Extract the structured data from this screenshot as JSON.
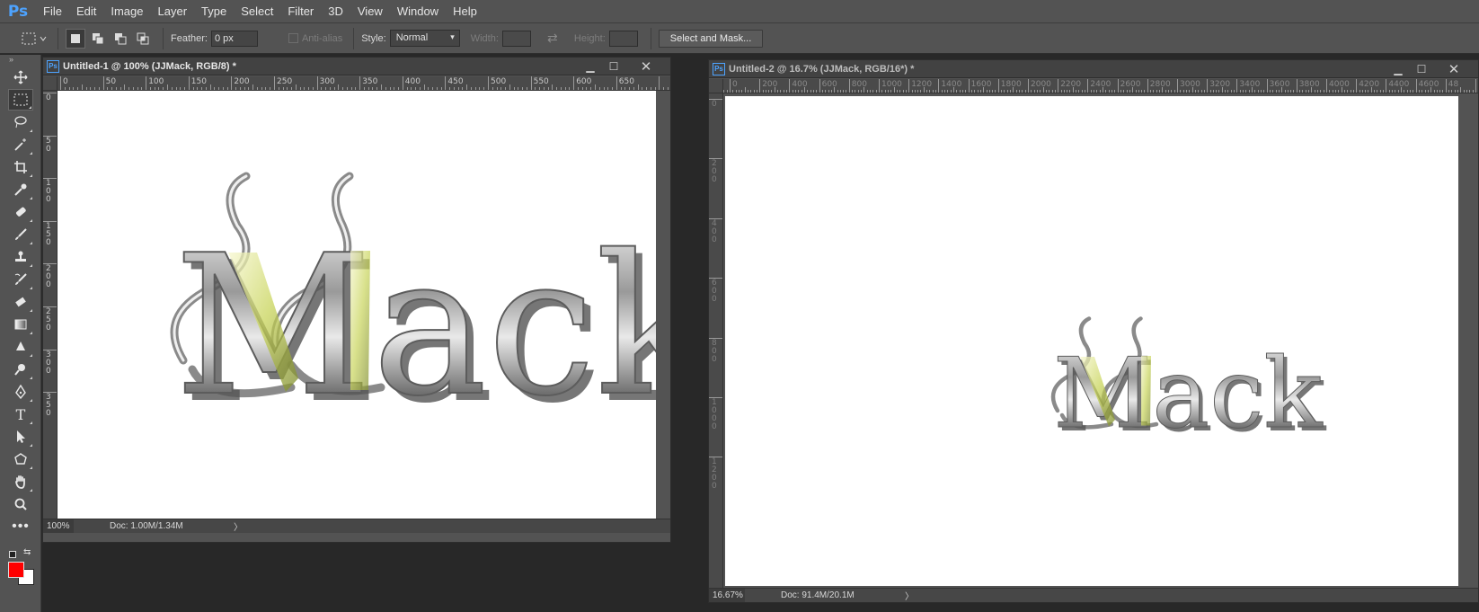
{
  "app": {
    "logo": "Ps"
  },
  "menu": [
    "File",
    "Edit",
    "Image",
    "Layer",
    "Type",
    "Select",
    "Filter",
    "3D",
    "View",
    "Window",
    "Help"
  ],
  "options": {
    "feather_label": "Feather:",
    "feather_value": "0 px",
    "antialias_label": "Anti-alias",
    "style_label": "Style:",
    "style_value": "Normal",
    "width_label": "Width:",
    "height_label": "Height:",
    "select_mask_label": "Select and Mask..."
  },
  "tools": [
    "move-tool",
    "rectangular-marquee-tool",
    "lasso-tool",
    "magic-wand-tool",
    "crop-tool",
    "eyedropper-tool",
    "healing-brush-tool",
    "brush-tool",
    "clone-stamp-tool",
    "history-brush-tool",
    "eraser-tool",
    "gradient-tool",
    "blur-tool",
    "dodge-tool",
    "pen-tool",
    "type-tool",
    "path-selection-tool",
    "shape-tool",
    "hand-tool",
    "zoom-tool",
    "more-tools"
  ],
  "colors": {
    "foreground": "#ff0000",
    "background": "#ffffff",
    "accent": "#4da3ff"
  },
  "doc1": {
    "badge": "Ps",
    "title": "Untitled-1 @ 100% (JJMack, RGB/8) *",
    "ruler_h": [
      "0",
      "50",
      "100",
      "150",
      "200",
      "250",
      "300",
      "350",
      "400",
      "450",
      "500",
      "550",
      "600",
      "650"
    ],
    "ruler_v": [
      "0",
      "50",
      "100",
      "150",
      "200",
      "250",
      "300",
      "350"
    ],
    "zoom": "100%",
    "docinfo": "Doc: 1.00M/1.34M",
    "artwork_text": "Mack"
  },
  "doc2": {
    "badge": "Ps",
    "title": "Untitled-2 @ 16.7% (JJMack, RGB/16*) *",
    "ruler_h": [
      "0",
      "200",
      "400",
      "600",
      "800",
      "1000",
      "1200",
      "1400",
      "1600",
      "1800",
      "2000",
      "2200",
      "2400",
      "2600",
      "2800",
      "3000",
      "3200",
      "3400",
      "3600",
      "3800",
      "4000",
      "4200",
      "4400",
      "4600",
      "48"
    ],
    "ruler_v": [
      "0",
      "200",
      "400",
      "600",
      "800",
      "1000",
      "1200"
    ],
    "zoom": "16.67%",
    "docinfo": "Doc: 91.4M/20.1M",
    "artwork_text": "Mack"
  }
}
